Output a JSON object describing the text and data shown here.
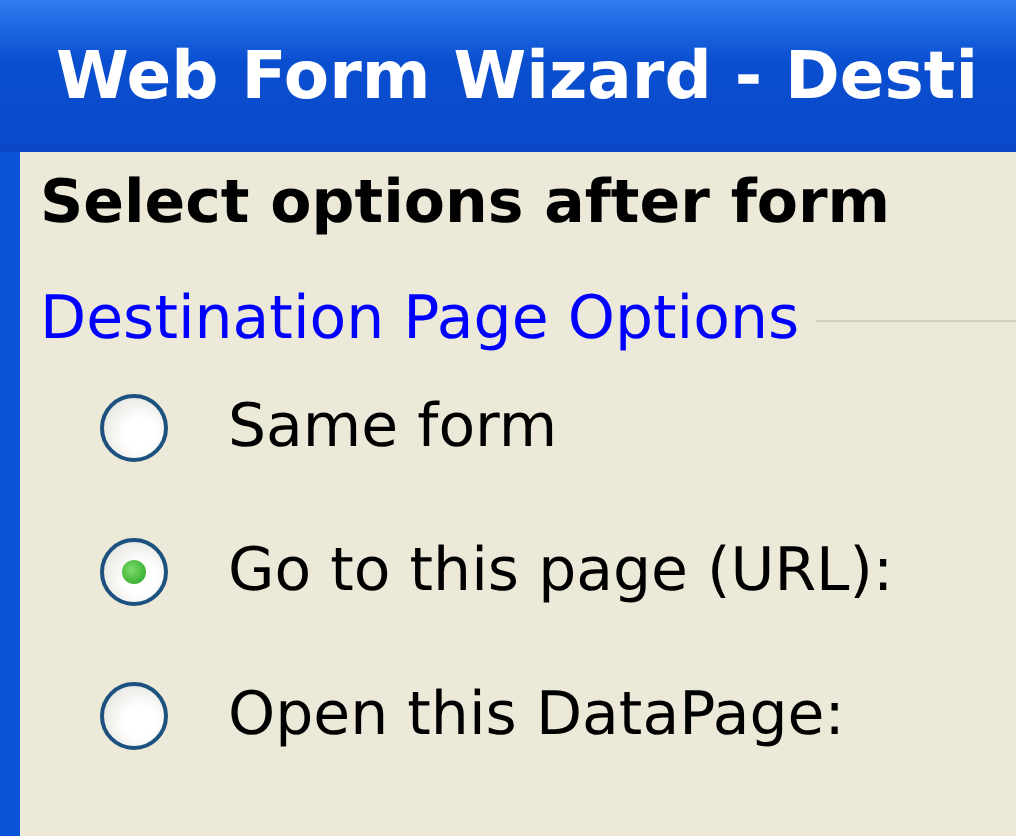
{
  "window": {
    "title": "Web Form Wizard - Desti"
  },
  "heading": "Select options after form",
  "group": {
    "title": "Destination Page Options",
    "options": [
      {
        "label": "Same form",
        "selected": false
      },
      {
        "label": "Go to this page (URL):",
        "selected": true
      },
      {
        "label": "Open this DataPage:",
        "selected": false
      }
    ]
  }
}
